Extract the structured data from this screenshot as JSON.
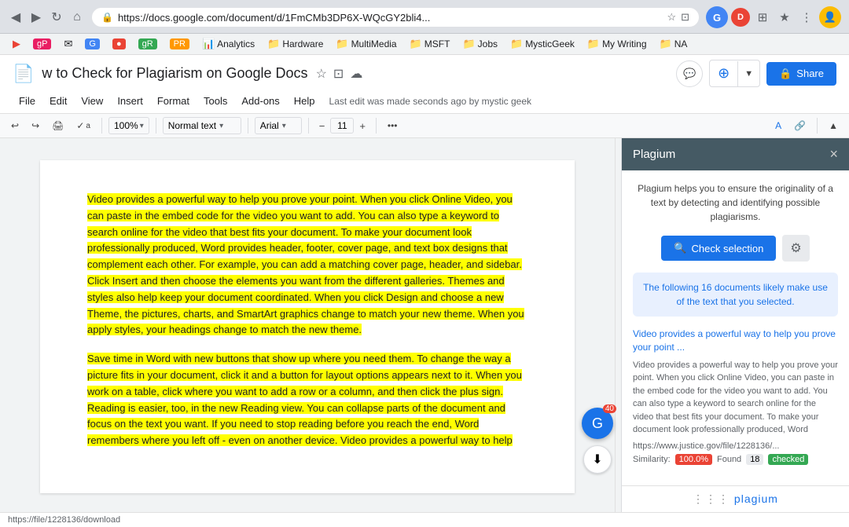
{
  "browser": {
    "url": "https://docs.google.com/document/d/1FmCMb3DP6X-WQcGY2bli4...",
    "back_icon": "◀",
    "forward_icon": "▶",
    "reload_icon": "↻",
    "home_icon": "⌂",
    "lock_icon": "🔒"
  },
  "bookmarks": [
    {
      "label": "gP",
      "color": "#e91e63"
    },
    {
      "label": "✉",
      "color": "#1565c0"
    },
    {
      "label": "G",
      "color": "#4285f4"
    },
    {
      "label": "gR",
      "color": "#34a853"
    },
    {
      "label": "PR",
      "color": "#e65100"
    },
    {
      "label": "Analytics",
      "color": "#f57c00"
    },
    {
      "label": "Hardware",
      "color": "#5f6368"
    },
    {
      "label": "MultiMedia",
      "color": "#5f6368"
    },
    {
      "label": "MSFT",
      "color": "#5f6368"
    },
    {
      "label": "Jobs",
      "color": "#5f6368"
    },
    {
      "label": "MysticGeek",
      "color": "#5f6368"
    },
    {
      "label": "My Writing",
      "color": "#5f6368"
    },
    {
      "label": "NA",
      "color": "#5f6368"
    }
  ],
  "docs": {
    "title": "w to Check for Plagiarism on Google Docs",
    "last_edit": "Last edit was made seconds ago by mystic geek",
    "menu_items": [
      "File",
      "Edit",
      "View",
      "Insert",
      "Format",
      "Tools",
      "Add-ons",
      "Help"
    ],
    "share_label": "Share",
    "toolbar": {
      "zoom": "100%",
      "style": "Normal text",
      "font": "Arial",
      "size": "11",
      "more_label": "•••"
    }
  },
  "document": {
    "para1": "Video provides a powerful way to help you prove your point. When you click Online Video, you can paste in the embed code for the video you want to add. You can also type a keyword to search online for the video that best fits your document. To make your document look professionally produced, Word provides header, footer, cover page, and text box designs that complement each other. For example, you can add a matching cover page, header, and sidebar. Click Insert and then choose the elements you want from the different galleries. Themes and styles also help keep your document coordinated. When you click Design and choose a new Theme, the pictures, charts, and SmartArt graphics change to match your new theme. When you apply styles, your headings change to match the new theme.",
    "para2": "Save time in Word with new buttons that show up where you need them. To change the way a picture fits in your document, click it and a button for layout options appears next to it. When you work on a table, click where you want to add a row or a column, and then click the plus sign. Reading is easier, too, in the new Reading view. You can collapse parts of the document and focus on the text you want. If you need to stop reading before you reach the end, Word remembers where you left off - even on another device. Video provides a powerful way to help"
  },
  "plagium": {
    "title": "Plagium",
    "close_icon": "×",
    "description": "Plagium helps you to ensure the originality of a text by detecting and identifying possible plagiarisms.",
    "check_selection_label": "Check selection",
    "gear_icon": "⚙",
    "results_info": "The following 16 documents likely make use of the text that you selected.",
    "result": {
      "title": "Video provides a powerful way to help you prove your point ...",
      "text": "Video provides a powerful way to help you prove your point. When you click Online Video, you can paste in the embed code for the video you want to add. You can also type a keyword to search online for the video that best fits your document. To make your document look professionally produced, Word",
      "url": "https://www.justice.gov/file/1228136/...",
      "similarity_label": "Similarity:",
      "similarity_value": "100.0%",
      "found_label": "Found",
      "found_value": "18",
      "checked_label": "checked"
    },
    "footer_logo": ":::plagium"
  },
  "status_bar": {
    "url": "https://file/1228136/download"
  }
}
